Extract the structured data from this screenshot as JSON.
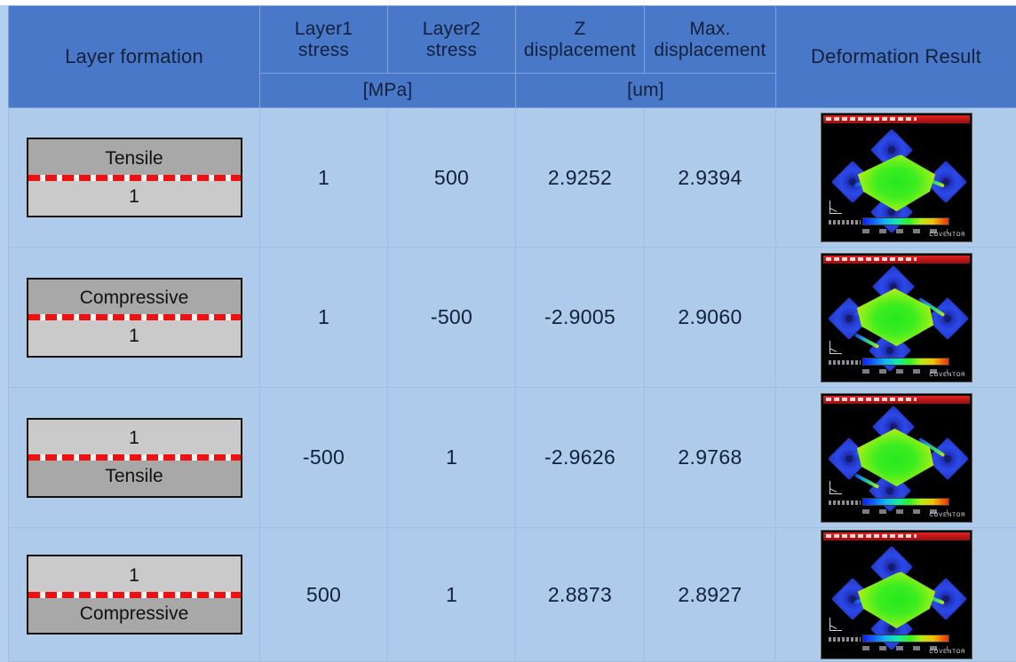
{
  "table": {
    "headers": {
      "layer_formation": "Layer formation",
      "layer1_stress": "Layer1\nstress",
      "layer1_stress_l1": "Layer1",
      "layer1_stress_l2": "stress",
      "layer2_stress_l1": "Layer2",
      "layer2_stress_l2": "stress",
      "z_disp_l1": "Z",
      "z_disp_l2": "displacement",
      "max_disp_l1": "Max.",
      "max_disp_l2": "displacement",
      "stress_unit": "[MPa]",
      "disp_unit": "[um]",
      "deformation_result": "Deformation Result"
    },
    "rows": [
      {
        "formation": {
          "top_label": "Tensile",
          "bottom_label": "1",
          "top_shade": "dark",
          "bottom_shade": "light"
        },
        "layer1_stress": "1",
        "layer2_stress": "500",
        "z_displacement": "2.9252",
        "max_displacement": "2.9394",
        "result_image": {
          "watermark": "COVENTOR",
          "curvature": "concave-up"
        }
      },
      {
        "formation": {
          "top_label": "Compressive",
          "bottom_label": "1",
          "top_shade": "dark",
          "bottom_shade": "light"
        },
        "layer1_stress": "1",
        "layer2_stress": "-500",
        "z_displacement": "-2.9005",
        "max_displacement": "2.9060",
        "result_image": {
          "watermark": "COVENTOR",
          "curvature": "concave-down"
        }
      },
      {
        "formation": {
          "top_label": "1",
          "bottom_label": "Tensile",
          "top_shade": "light",
          "bottom_shade": "dark"
        },
        "layer1_stress": "-500",
        "layer2_stress": "1",
        "z_displacement": "-2.9626",
        "max_displacement": "2.9768",
        "result_image": {
          "watermark": "COVENTOR",
          "curvature": "concave-down"
        }
      },
      {
        "formation": {
          "top_label": "1",
          "bottom_label": "Compressive",
          "top_shade": "light",
          "bottom_shade": "dark"
        },
        "layer1_stress": "500",
        "layer2_stress": "1",
        "z_displacement": "2.8873",
        "max_displacement": "2.8927",
        "result_image": {
          "watermark": "COVENTOR",
          "curvature": "concave-up"
        }
      }
    ]
  },
  "colors": {
    "header_blue": "#4a78c8",
    "body_blue": "#aecbeb",
    "page_blue": "#a9c8ec",
    "dash_red": "#ef1111",
    "layer_dark_gray": "#a8a8a8",
    "layer_light_gray": "#cacaca"
  }
}
